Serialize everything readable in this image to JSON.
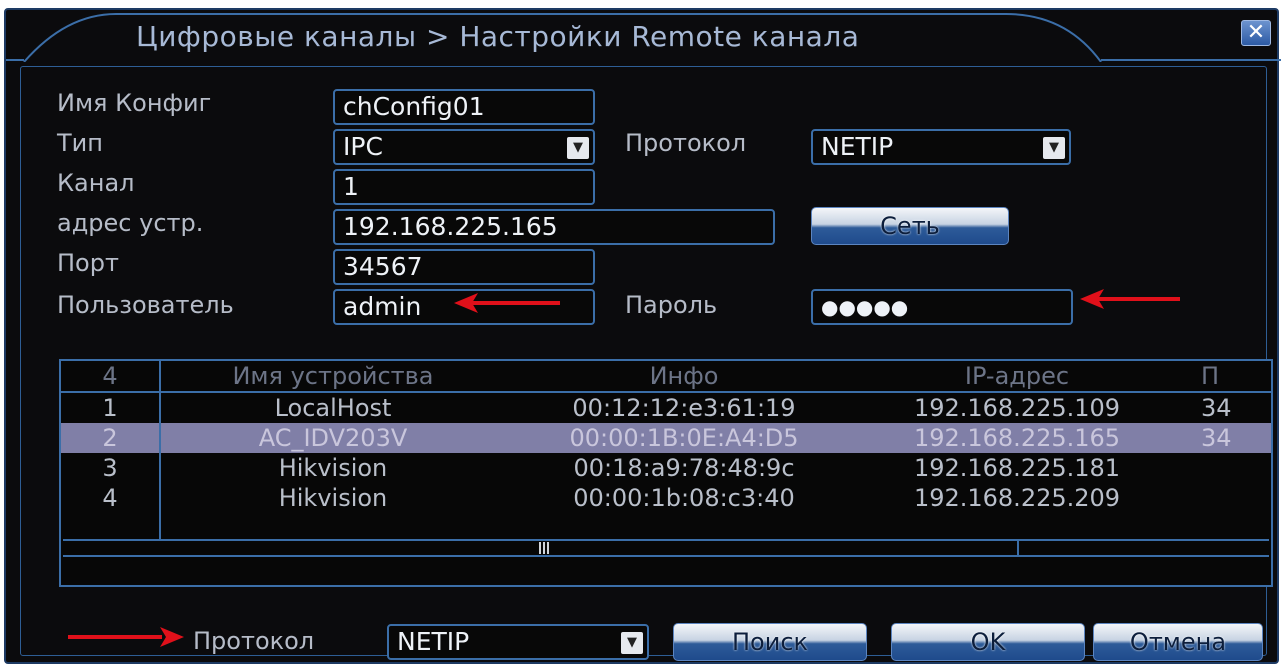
{
  "window": {
    "title": "Цифровые каналы > Настройки Remote канала",
    "close_glyph": "✕"
  },
  "form": {
    "config_name_label": "Имя Конфиг",
    "config_name_value": "chConfig01",
    "type_label": "Тип",
    "type_value": "IPC",
    "protocol_label": "Протокол",
    "protocol_value": "NETIP",
    "channel_label": "Канал",
    "channel_value": "1",
    "device_address_label": "адрес устр.",
    "device_address_value": "192.168.225.165",
    "network_button": "Сеть",
    "port_label": "Порт",
    "port_value": "34567",
    "user_label": "Пользователь",
    "user_value": "admin",
    "password_label": "Пароль",
    "password_value": "●●●●●"
  },
  "table": {
    "headers": [
      "4",
      "Имя устройства",
      "Инфо",
      "IP-адрес",
      "П"
    ],
    "rows": [
      {
        "index": "1",
        "name": "LocalHost",
        "info": "00:12:12:e3:61:19",
        "ip": "192.168.225.109",
        "port": "34"
      },
      {
        "index": "2",
        "name": "AC_IDV203V",
        "info": "00:00:1B:0E:A4:D5",
        "ip": "192.168.225.165",
        "port": "34"
      },
      {
        "index": "3",
        "name": "Hikvision",
        "info": "00:18:a9:78:48:9c",
        "ip": "192.168.225.181",
        "port": ""
      },
      {
        "index": "4",
        "name": "Hikvision",
        "info": "00:00:1b:08:c3:40",
        "ip": "192.168.225.209",
        "port": ""
      }
    ],
    "selected_row": 2
  },
  "footer": {
    "protocol_label": "Протокол",
    "protocol_value": "NETIP",
    "search_button": "Поиск",
    "ok_button": "OK",
    "cancel_button": "Отмена"
  },
  "colors": {
    "background": "#0b0b0d",
    "border": "#3b6ea8",
    "selected_row": "#807fa7",
    "annotation_arrow": "#e0101a"
  },
  "icons": {
    "close": "close-icon",
    "dropdown": "chevron-down-icon",
    "annotation": "red-arrow-icon"
  }
}
